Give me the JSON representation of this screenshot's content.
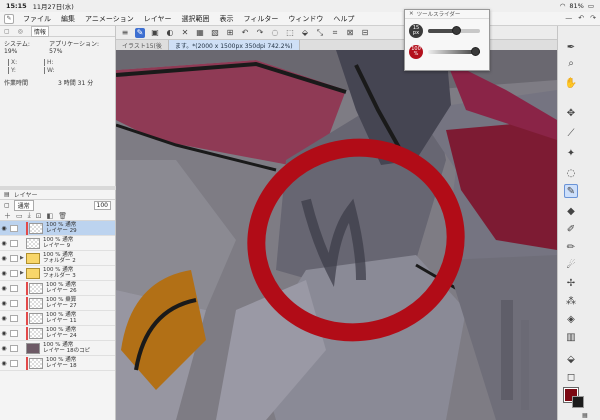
{
  "status_bar": {
    "time": "15:15",
    "date": "11月27日(水)",
    "battery": "81%"
  },
  "menu": {
    "items": [
      "ファイル",
      "編集",
      "アニメーション",
      "レイヤー",
      "選択範囲",
      "表示",
      "フィルター",
      "ウィンドウ",
      "ヘルプ"
    ]
  },
  "info_panel": {
    "tab": "情報",
    "system": "システム: 19%",
    "app": "アプリケーション: 57%",
    "work_time_label": "作業時間",
    "work_time": "3 時間 31 分",
    "coords": [
      "X:",
      "H:",
      "Y:",
      "W:"
    ]
  },
  "doc_tabs": [
    "イラスト15(後",
    "ます。*(2000 x 1500px 350dpi 742.2%)"
  ],
  "layer_panel": {
    "title": "レイヤー",
    "blend_mode": "通常",
    "opacity": "100",
    "layers": [
      {
        "line1": "100 % 通常",
        "line2": "レイヤー 29",
        "selected": true,
        "folder": false,
        "red": true,
        "thumb": "plain"
      },
      {
        "line1": "100 % 通常",
        "line2": "レイヤー 9",
        "selected": false,
        "folder": false,
        "red": false,
        "thumb": "plain"
      },
      {
        "line1": "100 % 通常",
        "line2": "フォルダー 2",
        "selected": false,
        "folder": true,
        "red": false,
        "thumb": "folder"
      },
      {
        "line1": "100 % 通常",
        "line2": "フォルダー 3",
        "selected": false,
        "folder": true,
        "red": false,
        "thumb": "folder"
      },
      {
        "line1": "100 % 通常",
        "line2": "レイヤー 26",
        "selected": false,
        "folder": false,
        "red": true,
        "thumb": "plain"
      },
      {
        "line1": "100 % 乗算",
        "line2": "レイヤー 27",
        "selected": false,
        "folder": false,
        "red": true,
        "thumb": "plain"
      },
      {
        "line1": "100 % 通常",
        "line2": "レイヤー 11",
        "selected": false,
        "folder": false,
        "red": true,
        "thumb": "plain"
      },
      {
        "line1": "100 % 通常",
        "line2": "レイヤー 24",
        "selected": false,
        "folder": false,
        "red": true,
        "thumb": "plain"
      },
      {
        "line1": "100 % 通常",
        "line2": "レイヤー 18のコピ",
        "selected": false,
        "folder": false,
        "red": false,
        "thumb": "dark"
      },
      {
        "line1": "100 % 通常",
        "line2": "レイヤー 18",
        "selected": false,
        "folder": false,
        "red": true,
        "thumb": "plain"
      }
    ]
  },
  "tool_slider": {
    "title": "ツールスライダー",
    "size_value": "15",
    "size_unit": "px",
    "opacity_value": "100",
    "opacity_unit": "%",
    "size_level": 0.55,
    "opacity_level": 1.0
  },
  "colors": {
    "main": "#7a0812",
    "sub": "#1b1b1b",
    "circle": "#b10c17"
  }
}
